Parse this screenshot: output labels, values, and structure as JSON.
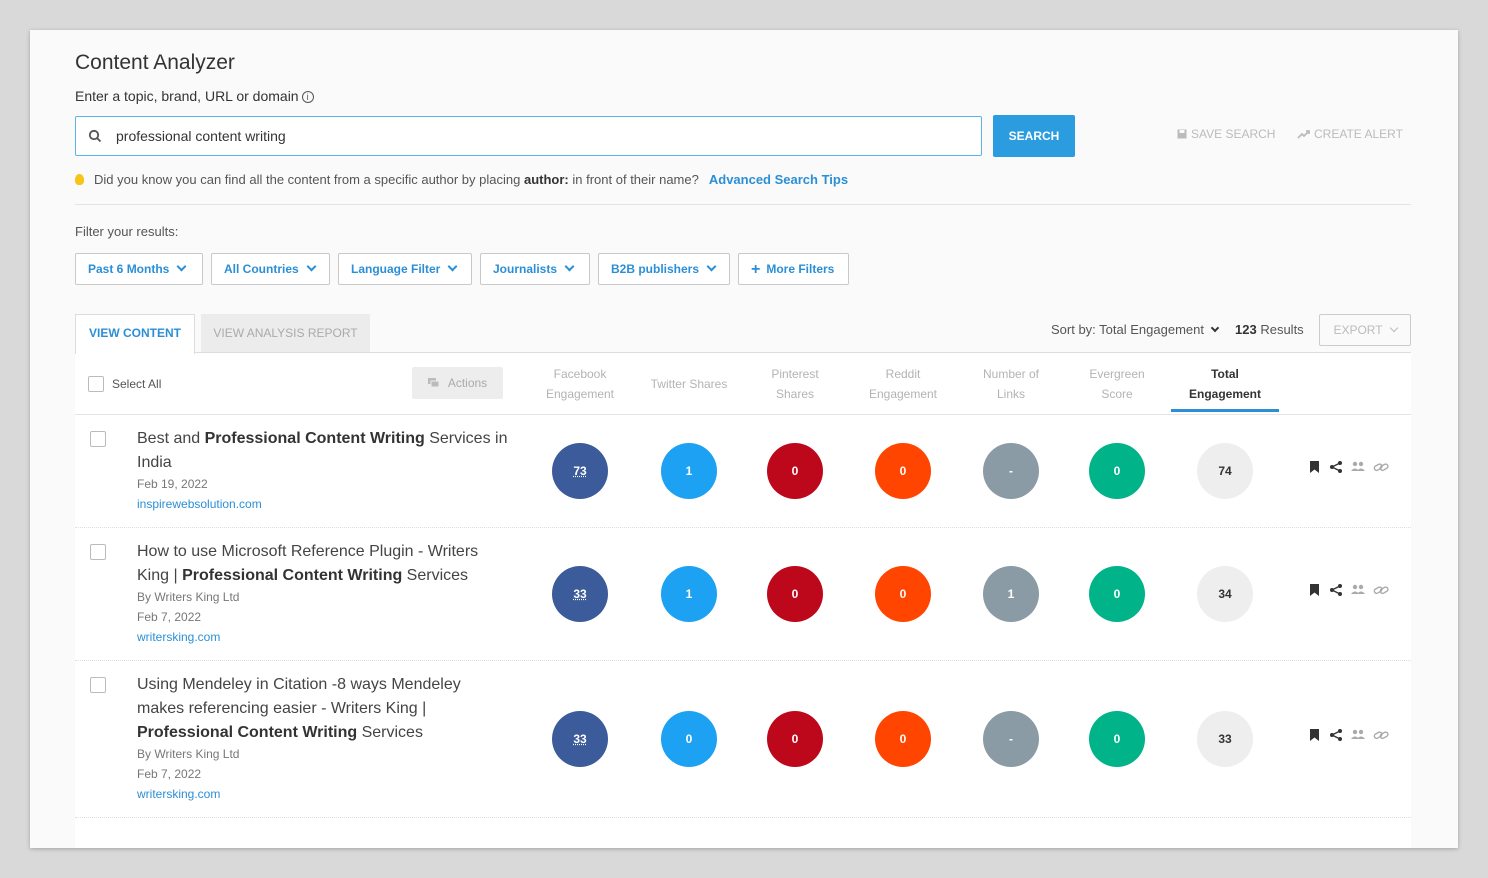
{
  "header": {
    "title": "Content Analyzer",
    "subtitle": "Enter a topic, brand, URL or domain"
  },
  "search": {
    "value": "professional content writing",
    "button_label": "SEARCH",
    "save_label": "SAVE SEARCH",
    "alert_label": "CREATE ALERT"
  },
  "tip": {
    "before": "Did you know you can find all the content from a specific author by placing",
    "keyword": "author:",
    "after": "in front of their name?",
    "link": "Advanced Search Tips"
  },
  "filters": {
    "label": "Filter your results:",
    "items": [
      "Past 6 Months",
      "All Countries",
      "Language Filter",
      "Journalists",
      "B2B publishers"
    ],
    "more": "More Filters"
  },
  "tabs": {
    "view_content": "VIEW CONTENT",
    "analysis_report": "VIEW ANALYSIS REPORT"
  },
  "toolbar": {
    "sort_label": "Sort by: Total Engagement",
    "results_count": "123",
    "results_label": "Results",
    "export_label": "EXPORT"
  },
  "table": {
    "select_all": "Select All",
    "actions": "Actions",
    "columns": [
      {
        "line1": "Facebook",
        "line2": "Engagement"
      },
      {
        "line1": "Twitter Shares",
        "line2": ""
      },
      {
        "line1": "Pinterest",
        "line2": "Shares"
      },
      {
        "line1": "Reddit",
        "line2": "Engagement"
      },
      {
        "line1": "Number of",
        "line2": "Links"
      },
      {
        "line1": "Evergreen",
        "line2": "Score"
      },
      {
        "line1": "Total",
        "line2": "Engagement"
      }
    ],
    "rows": [
      {
        "title_a": "Best and ",
        "title_bold": "Professional Content Writing",
        "title_b": " Services in India",
        "author": "",
        "date": "Feb 19, 2022",
        "domain": "inspirewebsolution.com",
        "facebook": "73",
        "twitter": "1",
        "pinterest": "0",
        "reddit": "0",
        "links": "-",
        "evergreen": "0",
        "total": "74"
      },
      {
        "title_a": "How to use Microsoft Reference Plugin - Writers King | ",
        "title_bold": "Professional Content Writing",
        "title_b": " Services",
        "author": "By  Writers King Ltd",
        "date": "Feb 7, 2022",
        "domain": "writersking.com",
        "facebook": "33",
        "twitter": "1",
        "pinterest": "0",
        "reddit": "0",
        "links": "1",
        "evergreen": "0",
        "total": "34"
      },
      {
        "title_a": "Using Mendeley in Citation -8 ways Mendeley makes referencing easier - Writers King | ",
        "title_bold": "Professional Content Writing",
        "title_b": " Services",
        "author": "By  Writers King Ltd",
        "date": "Feb 7, 2022",
        "domain": "writersking.com",
        "facebook": "33",
        "twitter": "0",
        "pinterest": "0",
        "reddit": "0",
        "links": "-",
        "evergreen": "0",
        "total": "33"
      }
    ]
  }
}
